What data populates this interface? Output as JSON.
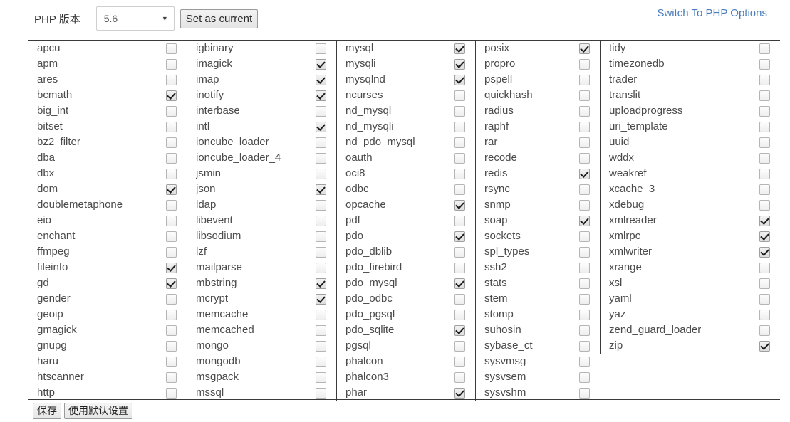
{
  "header": {
    "version_label": "PHP 版本",
    "version_selected": "5.6",
    "version_caret_icon": "chevron-down-icon",
    "set_current_label": "Set as current",
    "switch_link_label": "Switch To PHP Options",
    "link_color": "#4a7ebb"
  },
  "footer": {
    "save_label": "保存",
    "default_label": "使用默认设置"
  },
  "extensions": {
    "columns": [
      {
        "items": [
          {
            "name": "apcu",
            "checked": false
          },
          {
            "name": "apm",
            "checked": false
          },
          {
            "name": "ares",
            "checked": false
          },
          {
            "name": "bcmath",
            "checked": true
          },
          {
            "name": "big_int",
            "checked": false
          },
          {
            "name": "bitset",
            "checked": false
          },
          {
            "name": "bz2_filter",
            "checked": false
          },
          {
            "name": "dba",
            "checked": false
          },
          {
            "name": "dbx",
            "checked": false
          },
          {
            "name": "dom",
            "checked": true
          },
          {
            "name": "doublemetaphone",
            "checked": false
          },
          {
            "name": "eio",
            "checked": false
          },
          {
            "name": "enchant",
            "checked": false
          },
          {
            "name": "ffmpeg",
            "checked": false
          },
          {
            "name": "fileinfo",
            "checked": true
          },
          {
            "name": "gd",
            "checked": true
          },
          {
            "name": "gender",
            "checked": false
          },
          {
            "name": "geoip",
            "checked": false
          },
          {
            "name": "gmagick",
            "checked": false
          },
          {
            "name": "gnupg",
            "checked": false
          },
          {
            "name": "haru",
            "checked": false
          },
          {
            "name": "htscanner",
            "checked": false
          },
          {
            "name": "http",
            "checked": false
          }
        ]
      },
      {
        "items": [
          {
            "name": "igbinary",
            "checked": false
          },
          {
            "name": "imagick",
            "checked": true
          },
          {
            "name": "imap",
            "checked": true
          },
          {
            "name": "inotify",
            "checked": true
          },
          {
            "name": "interbase",
            "checked": false
          },
          {
            "name": "intl",
            "checked": true
          },
          {
            "name": "ioncube_loader",
            "checked": false
          },
          {
            "name": "ioncube_loader_4",
            "checked": false
          },
          {
            "name": "jsmin",
            "checked": false
          },
          {
            "name": "json",
            "checked": true
          },
          {
            "name": "ldap",
            "checked": false
          },
          {
            "name": "libevent",
            "checked": false
          },
          {
            "name": "libsodium",
            "checked": false
          },
          {
            "name": "lzf",
            "checked": false
          },
          {
            "name": "mailparse",
            "checked": false
          },
          {
            "name": "mbstring",
            "checked": true
          },
          {
            "name": "mcrypt",
            "checked": true
          },
          {
            "name": "memcache",
            "checked": false
          },
          {
            "name": "memcached",
            "checked": false
          },
          {
            "name": "mongo",
            "checked": false
          },
          {
            "name": "mongodb",
            "checked": false
          },
          {
            "name": "msgpack",
            "checked": false
          },
          {
            "name": "mssql",
            "checked": false
          }
        ]
      },
      {
        "items": [
          {
            "name": "mysql",
            "checked": true
          },
          {
            "name": "mysqli",
            "checked": true
          },
          {
            "name": "mysqlnd",
            "checked": true
          },
          {
            "name": "ncurses",
            "checked": false
          },
          {
            "name": "nd_mysql",
            "checked": false
          },
          {
            "name": "nd_mysqli",
            "checked": false
          },
          {
            "name": "nd_pdo_mysql",
            "checked": false
          },
          {
            "name": "oauth",
            "checked": false
          },
          {
            "name": "oci8",
            "checked": false
          },
          {
            "name": "odbc",
            "checked": false
          },
          {
            "name": "opcache",
            "checked": true
          },
          {
            "name": "pdf",
            "checked": false
          },
          {
            "name": "pdo",
            "checked": true
          },
          {
            "name": "pdo_dblib",
            "checked": false
          },
          {
            "name": "pdo_firebird",
            "checked": false
          },
          {
            "name": "pdo_mysql",
            "checked": true
          },
          {
            "name": "pdo_odbc",
            "checked": false
          },
          {
            "name": "pdo_pgsql",
            "checked": false
          },
          {
            "name": "pdo_sqlite",
            "checked": true
          },
          {
            "name": "pgsql",
            "checked": false
          },
          {
            "name": "phalcon",
            "checked": false
          },
          {
            "name": "phalcon3",
            "checked": false
          },
          {
            "name": "phar",
            "checked": true
          }
        ]
      },
      {
        "items": [
          {
            "name": "posix",
            "checked": true
          },
          {
            "name": "propro",
            "checked": false
          },
          {
            "name": "pspell",
            "checked": false
          },
          {
            "name": "quickhash",
            "checked": false
          },
          {
            "name": "radius",
            "checked": false
          },
          {
            "name": "raphf",
            "checked": false
          },
          {
            "name": "rar",
            "checked": false
          },
          {
            "name": "recode",
            "checked": false
          },
          {
            "name": "redis",
            "checked": true
          },
          {
            "name": "rsync",
            "checked": false
          },
          {
            "name": "snmp",
            "checked": false
          },
          {
            "name": "soap",
            "checked": true
          },
          {
            "name": "sockets",
            "checked": false
          },
          {
            "name": "spl_types",
            "checked": false
          },
          {
            "name": "ssh2",
            "checked": false
          },
          {
            "name": "stats",
            "checked": false
          },
          {
            "name": "stem",
            "checked": false
          },
          {
            "name": "stomp",
            "checked": false
          },
          {
            "name": "suhosin",
            "checked": false
          },
          {
            "name": "sybase_ct",
            "checked": false
          },
          {
            "name": "sysvmsg",
            "checked": false
          },
          {
            "name": "sysvsem",
            "checked": false
          },
          {
            "name": "sysvshm",
            "checked": false
          }
        ]
      },
      {
        "items": [
          {
            "name": "tidy",
            "checked": false
          },
          {
            "name": "timezonedb",
            "checked": false
          },
          {
            "name": "trader",
            "checked": false
          },
          {
            "name": "translit",
            "checked": false
          },
          {
            "name": "uploadprogress",
            "checked": false
          },
          {
            "name": "uri_template",
            "checked": false
          },
          {
            "name": "uuid",
            "checked": false
          },
          {
            "name": "wddx",
            "checked": false
          },
          {
            "name": "weakref",
            "checked": false
          },
          {
            "name": "xcache_3",
            "checked": false
          },
          {
            "name": "xdebug",
            "checked": false
          },
          {
            "name": "xmlreader",
            "checked": true
          },
          {
            "name": "xmlrpc",
            "checked": true
          },
          {
            "name": "xmlwriter",
            "checked": true
          },
          {
            "name": "xrange",
            "checked": false
          },
          {
            "name": "xsl",
            "checked": false
          },
          {
            "name": "yaml",
            "checked": false
          },
          {
            "name": "yaz",
            "checked": false
          },
          {
            "name": "zend_guard_loader",
            "checked": false
          },
          {
            "name": "zip",
            "checked": true
          }
        ]
      }
    ]
  }
}
